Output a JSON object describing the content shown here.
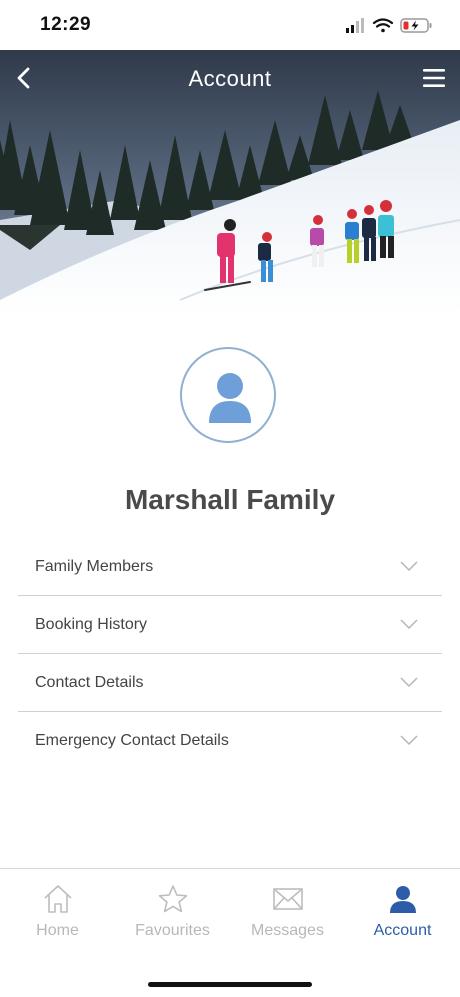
{
  "status": {
    "time": "12:29"
  },
  "header": {
    "title": "Account"
  },
  "profile": {
    "name": "Marshall Family"
  },
  "sections": [
    {
      "label": "Family Members"
    },
    {
      "label": "Booking History"
    },
    {
      "label": "Contact Details"
    },
    {
      "label": "Emergency Contact Details"
    }
  ],
  "tabs": [
    {
      "label": "Home",
      "icon": "home-icon",
      "active": false
    },
    {
      "label": "Favourites",
      "icon": "star-icon",
      "active": false
    },
    {
      "label": "Messages",
      "icon": "envelope-icon",
      "active": false
    },
    {
      "label": "Account",
      "icon": "person-icon",
      "active": true
    }
  ],
  "colors": {
    "accent": "#2d5da8",
    "avatar": "#6f9fd8",
    "inactive": "#b8b8b8"
  }
}
